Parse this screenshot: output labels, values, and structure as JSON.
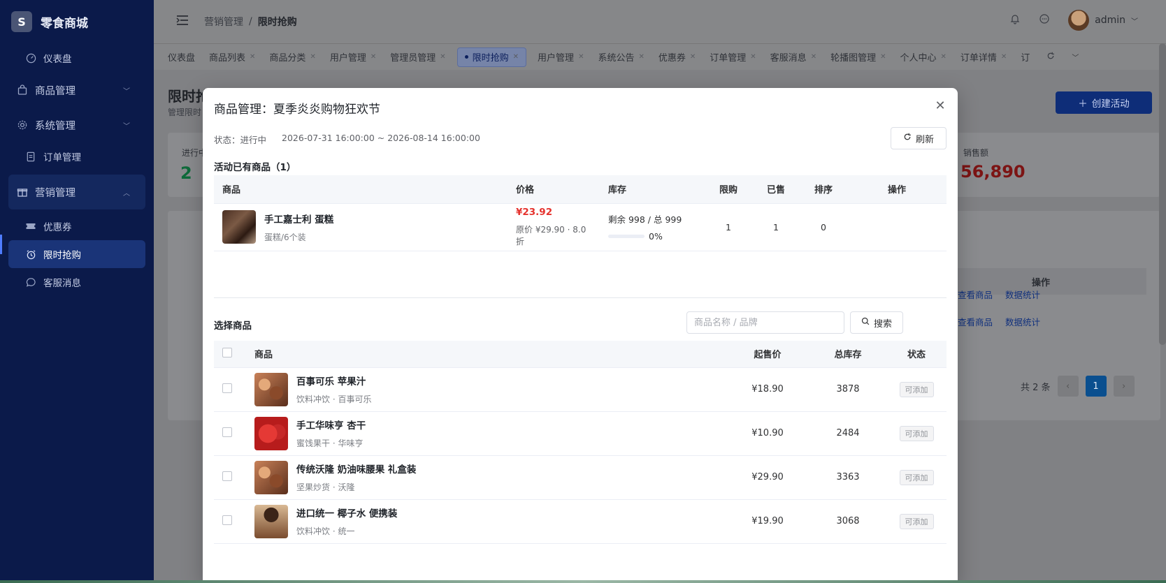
{
  "brand": {
    "logo": "S",
    "name": "零食商城"
  },
  "sidebar": {
    "items": [
      {
        "label": "仪表盘",
        "icon": "gauge-icon"
      },
      {
        "label": "商品管理",
        "icon": "bag-icon"
      },
      {
        "label": "系统管理",
        "icon": "gear-icon"
      },
      {
        "label": "订单管理",
        "icon": "document-icon"
      },
      {
        "label": "营销管理",
        "icon": "gift-icon"
      },
      {
        "label": "优惠券",
        "icon": "ticket-icon"
      },
      {
        "label": "限时抢购",
        "icon": "alarm-icon"
      },
      {
        "label": "客服消息",
        "icon": "chat-icon"
      }
    ]
  },
  "header": {
    "breadcrumb": [
      "营销管理",
      "限时抢购"
    ],
    "separator": "/",
    "user": "admin"
  },
  "tabs": [
    "仪表盘",
    "商品列表",
    "商品分类",
    "用户管理",
    "管理员管理",
    "限时抢购",
    "用户管理",
    "系统公告",
    "优惠券",
    "订单管理",
    "客服消息",
    "轮播图管理",
    "个人中心",
    "订单详情",
    "订"
  ],
  "page": {
    "title": "限时抢",
    "subtitle": "管理限时",
    "create_label": "创建活动",
    "stat_left": {
      "label": "进行中",
      "value": "2"
    },
    "stat_right": {
      "label": "销售额",
      "value": "56,890"
    },
    "op_header": "操作",
    "row_links": [
      "查看商品",
      "数据统计"
    ],
    "pager_total": "共 2 条",
    "pager_current": "1"
  },
  "modal": {
    "title": "商品管理：夏季炎炎购物狂欢节",
    "status": "状态：进行中",
    "time_range": "2026-07-31 16:00:00 ~ 2026-08-14 16:00:00",
    "refresh_label": "刷新",
    "existing_title": "活动已有商品（1）",
    "existing_headers": [
      "商品",
      "价格",
      "库存",
      "限购",
      "已售",
      "排序",
      "操作"
    ],
    "existing_rows": [
      {
        "name": "手工嘉士利 蛋糕",
        "sub": "蛋糕/6个装",
        "price": "¥23.92",
        "price_sub": "原价 ¥29.90 · 8.0折",
        "stock": "剩余 998 / 总 999",
        "stock_pct": "0%",
        "limit": "1",
        "sold": "1",
        "sort": "0"
      }
    ],
    "select_title": "选择商品",
    "search_placeholder": "商品名称 / 品牌",
    "search_label": "搜索",
    "select_headers": [
      "商品",
      "起售价",
      "总库存",
      "状态"
    ],
    "select_rows": [
      {
        "name": "百事可乐 苹果汁",
        "sub": "饮料冲饮 · 百事可乐",
        "price": "¥18.90",
        "stock": "3878",
        "status": "可添加"
      },
      {
        "name": "手工华味亨 杏干",
        "sub": "蜜饯果干 · 华味亨",
        "price": "¥10.90",
        "stock": "2484",
        "status": "可添加"
      },
      {
        "name": "传统沃隆 奶油味腰果 礼盒装",
        "sub": "坚果炒货 · 沃隆",
        "price": "¥29.90",
        "stock": "3363",
        "status": "可添加"
      },
      {
        "name": "进口统一 椰子水 便携装",
        "sub": "饮料冲饮 · 统一",
        "price": "¥19.90",
        "stock": "3068",
        "status": "可添加"
      }
    ]
  }
}
